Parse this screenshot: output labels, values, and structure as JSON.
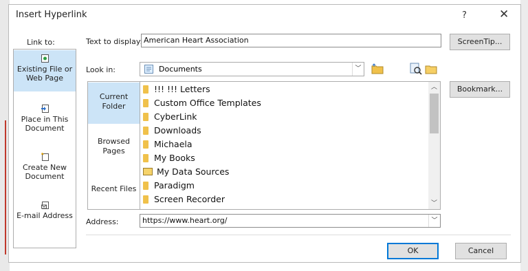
{
  "dialog": {
    "title": "Insert Hyperlink",
    "help": "?",
    "close": "✕"
  },
  "link_to": {
    "label": "Link to:",
    "items": [
      {
        "line1": "Existing File or",
        "line2": "Web Page",
        "icon": "existing-file-icon",
        "selected": true
      },
      {
        "line1": "Place in This",
        "line2": "Document",
        "icon": "place-in-document-icon",
        "selected": false
      },
      {
        "line1": "Create New",
        "line2": "Document",
        "icon": "new-document-icon",
        "selected": false
      },
      {
        "line1": "E-mail Address",
        "line2": "",
        "icon": "email-icon",
        "selected": false
      }
    ]
  },
  "text_to_display": {
    "label": "Text to display:",
    "value": "American Heart Association"
  },
  "look_in": {
    "label": "Look in:",
    "value": "Documents"
  },
  "browse": {
    "current_folder_1": "Current",
    "current_folder_2": "Folder",
    "browsed_pages_1": "Browsed",
    "browsed_pages_2": "Pages",
    "recent_files": "Recent Files"
  },
  "files": [
    {
      "name": "!!! !!! Letters",
      "icon": "folder-icon"
    },
    {
      "name": "Custom Office Templates",
      "icon": "folder-icon"
    },
    {
      "name": "CyberLink",
      "icon": "folder-icon"
    },
    {
      "name": "Downloads",
      "icon": "folder-icon"
    },
    {
      "name": "Michaela",
      "icon": "folder-icon"
    },
    {
      "name": "My Books",
      "icon": "folder-icon"
    },
    {
      "name": "My Data Sources",
      "icon": "data-sources-icon"
    },
    {
      "name": "Paradigm",
      "icon": "folder-icon"
    },
    {
      "name": "Screen Recorder",
      "icon": "folder-icon"
    }
  ],
  "address": {
    "label": "Address:",
    "value": "https://www.heart.org/"
  },
  "buttons": {
    "screentip": "ScreenTip...",
    "bookmark": "Bookmark...",
    "ok": "OK",
    "cancel": "Cancel"
  },
  "colors": {
    "accent": "#0078d7",
    "selected_bg": "#cce4f7",
    "folder": "#f0c14b"
  }
}
